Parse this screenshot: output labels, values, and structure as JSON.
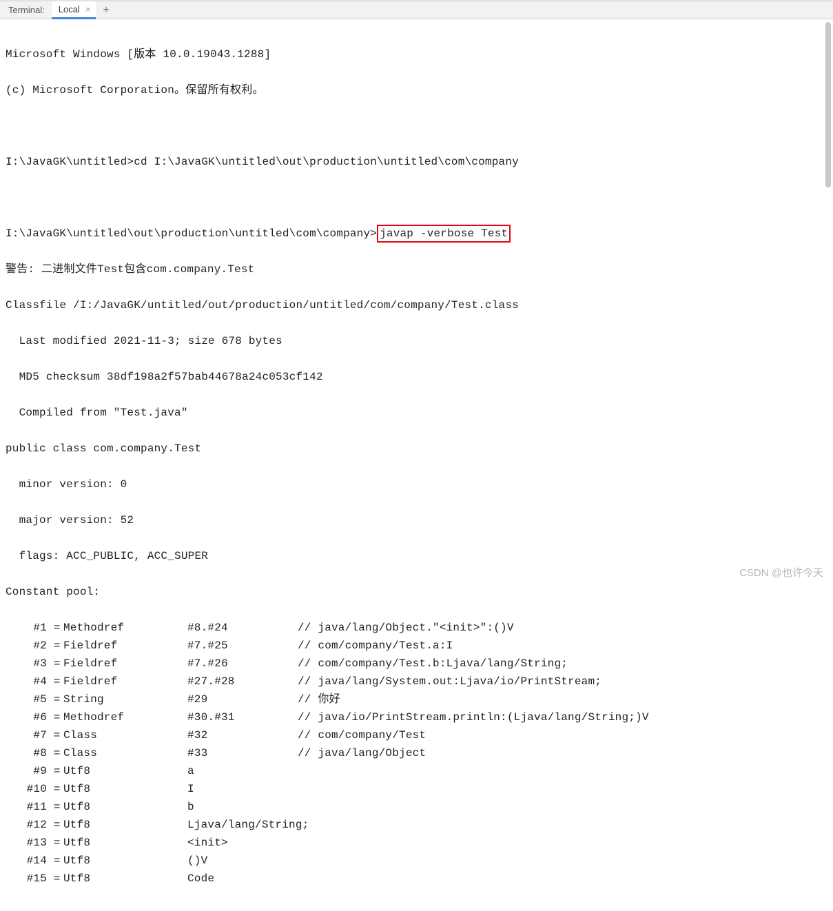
{
  "tabbar": {
    "title": "Terminal:",
    "active_tab": "Local",
    "close_glyph": "×",
    "add_glyph": "+"
  },
  "terminal": {
    "line_win_version": "Microsoft Windows [版本 10.0.19043.1288]",
    "line_copyright": "(c) Microsoft Corporation。保留所有权利。",
    "prompt1_prefix": "I:\\JavaGK\\untitled>",
    "prompt1_cmd": "cd I:\\JavaGK\\untitled\\out\\production\\untitled\\com\\company",
    "prompt2_prefix": "I:\\JavaGK\\untitled\\out\\production\\untitled\\com\\company>",
    "prompt2_cmd": "javap -verbose Test",
    "warning": "警告: 二进制文件Test包含com.company.Test",
    "classfile": "Classfile /I:/JavaGK/untitled/out/production/untitled/com/company/Test.class",
    "last_modified": "  Last modified 2021-11-3; size 678 bytes",
    "md5": "  MD5 checksum 38df198a2f57bab44678a24c053cf142",
    "compiled_from": "  Compiled from \"Test.java\"",
    "class_decl": "public class com.company.Test",
    "minor": "  minor version: 0",
    "major": "  major version: 52",
    "flags": "  flags: ACC_PUBLIC, ACC_SUPER",
    "cp_header": "Constant pool:",
    "cp": [
      {
        "idx": "#1",
        "kind": "Methodref",
        "ref": "#8.#24",
        "com": "// java/lang/Object.\"<init>\":()V"
      },
      {
        "idx": "#2",
        "kind": "Fieldref",
        "ref": "#7.#25",
        "com": "// com/company/Test.a:I"
      },
      {
        "idx": "#3",
        "kind": "Fieldref",
        "ref": "#7.#26",
        "com": "// com/company/Test.b:Ljava/lang/String;"
      },
      {
        "idx": "#4",
        "kind": "Fieldref",
        "ref": "#27.#28",
        "com": "// java/lang/System.out:Ljava/io/PrintStream;"
      },
      {
        "idx": "#5",
        "kind": "String",
        "ref": "#29",
        "com": "// 你好"
      },
      {
        "idx": "#6",
        "kind": "Methodref",
        "ref": "#30.#31",
        "com": "// java/io/PrintStream.println:(Ljava/lang/String;)V"
      },
      {
        "idx": "#7",
        "kind": "Class",
        "ref": "#32",
        "com": "// com/company/Test"
      },
      {
        "idx": "#8",
        "kind": "Class",
        "ref": "#33",
        "com": "// java/lang/Object"
      },
      {
        "idx": "#9",
        "kind": "Utf8",
        "ref": "a",
        "com": ""
      },
      {
        "idx": "#10",
        "kind": "Utf8",
        "ref": "I",
        "com": ""
      },
      {
        "idx": "#11",
        "kind": "Utf8",
        "ref": "b",
        "com": ""
      },
      {
        "idx": "#12",
        "kind": "Utf8",
        "ref": "Ljava/lang/String;",
        "com": ""
      },
      {
        "idx": "#13",
        "kind": "Utf8",
        "ref": "<init>",
        "com": ""
      },
      {
        "idx": "#14",
        "kind": "Utf8",
        "ref": "()V",
        "com": ""
      },
      {
        "idx": "#15",
        "kind": "Utf8",
        "ref": "Code",
        "com": ""
      }
    ]
  },
  "watermark": "CSDN @也许今天"
}
